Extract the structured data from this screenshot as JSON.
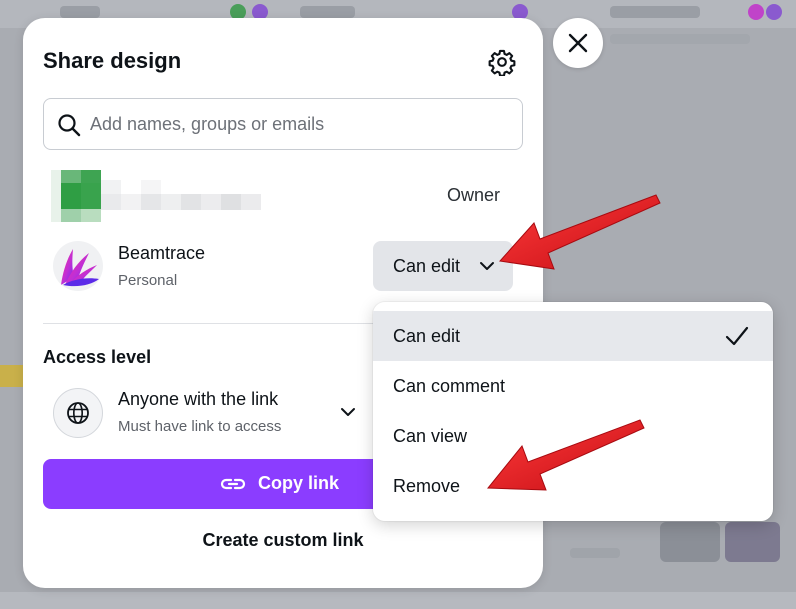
{
  "dialog": {
    "title": "Share design",
    "settings_icon": "gear-icon",
    "close_icon": "close-icon"
  },
  "search": {
    "placeholder": "Add names, groups or emails",
    "value": "",
    "icon": "search-icon"
  },
  "owner": {
    "role": "Owner"
  },
  "member": {
    "name": "Beamtrace",
    "subtitle": "Personal",
    "permission": "Can edit"
  },
  "access": {
    "title": "Access level",
    "option": "Anyone with the link",
    "description": "Must have link to access",
    "icon": "globe-icon"
  },
  "actions": {
    "copy_link": "Copy link",
    "custom_link": "Create custom link"
  },
  "permission_menu": {
    "items": [
      {
        "label": "Can edit",
        "selected": true
      },
      {
        "label": "Can comment",
        "selected": false
      },
      {
        "label": "Can view",
        "selected": false
      },
      {
        "label": "Remove",
        "selected": false
      }
    ]
  },
  "colors": {
    "accent": "#8b3dff",
    "annotation_arrow": "#e0121b"
  }
}
